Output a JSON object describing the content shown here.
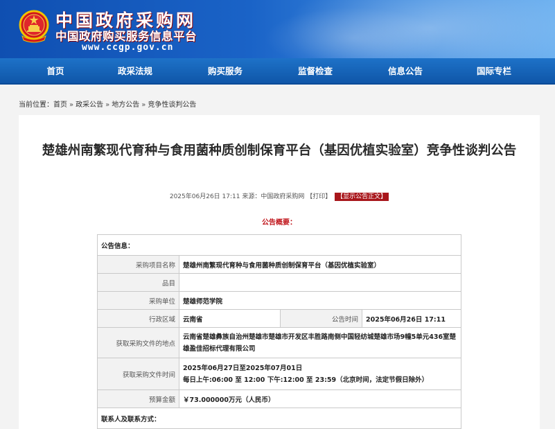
{
  "header": {
    "site_name": "中国政府采购网",
    "site_subtitle": "中国政府购买服务信息平台",
    "url": "www.ccgp.gov.cn",
    "emblem_icon": "national-emblem-icon"
  },
  "nav": {
    "items": [
      "首页",
      "政采法规",
      "购买服务",
      "监督检查",
      "信息公告",
      "国际专栏"
    ]
  },
  "breadcrumb": {
    "prefix": "当前位置：",
    "items": [
      "首页",
      "政采公告",
      "地方公告",
      "竞争性谈判公告"
    ],
    "separator": "»"
  },
  "article": {
    "title": "楚雄州南繁现代育种与食用菌种质创制保育平台（基因优植实验室）竞争性谈判公告",
    "meta_date": "2025年06月26日 17:11",
    "meta_source": "来源：中国政府采购网",
    "meta_print": "【打印】",
    "meta_show": "【显示公告正文】",
    "summary_label": "公告概要："
  },
  "table": {
    "section_info": "公告信息：",
    "project_name_label": "采购项目名称",
    "project_name": "楚雄州南繁现代育种与食用菌种质创制保育平台（基因优植实验室）",
    "item_label": "品目",
    "item_value": "",
    "buyer_label": "采购单位",
    "buyer": "楚雄师范学院",
    "region_label": "行政区域",
    "region": "云南省",
    "pub_time_label": "公告时间",
    "pub_time": "2025年06月26日 17:11",
    "doc_place_label": "获取采购文件的地点",
    "doc_place": "云南省楚雄彝族自治州楚雄市楚雄市开发区丰胜路南侧中国轻纺城楚雄市场9幢5单元436室楚雄盈佳招标代理有限公司",
    "doc_time_label": "获取采购文件时间",
    "doc_time_line1": "2025年06月27日至2025年07月01日",
    "doc_time_line2": "每日上午:06:00 至 12:00  下午:12:00 至 23:59（北京时间，法定节假日除外）",
    "budget_label": "预算金额",
    "budget": "￥73.000000万元（人民币）",
    "section_contact": "联系人及联系方式："
  },
  "colors": {
    "brand_blue": "#1a63c7",
    "nav_blue": "#0f56a8",
    "accent_red": "#c0151b",
    "button_red": "#a8161b"
  }
}
